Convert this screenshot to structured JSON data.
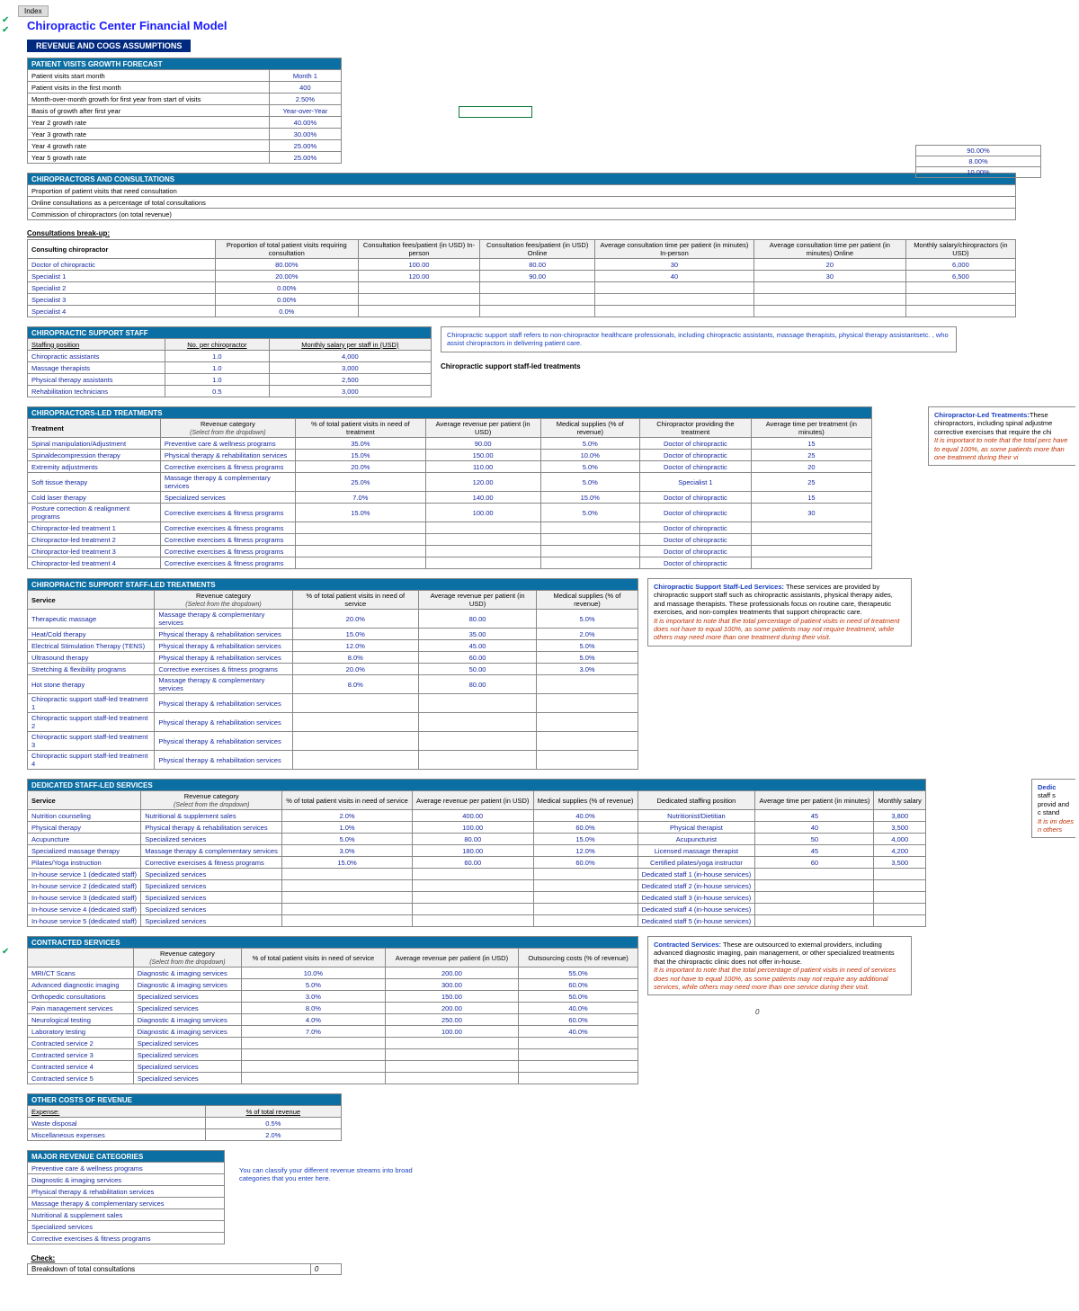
{
  "index_btn": "Index",
  "title": "Chiropractic Center Financial Model",
  "section_bar": "REVENUE AND COGS ASSUMPTIONS",
  "patient_visits": {
    "header": "PATIENT VISITS GROWTH FORECAST",
    "rows": [
      {
        "label": "Patient visits start month",
        "val": "Month 1"
      },
      {
        "label": "Patient visits in the first month",
        "val": "400"
      },
      {
        "label": "Month-over-month growth for first year from start of visits",
        "val": "2.50%"
      },
      {
        "label": "Basis of growth after first year",
        "val": "Year-over-Year"
      },
      {
        "label": "Year 2 growth rate",
        "val": "40.00%"
      },
      {
        "label": "Year 3 growth rate",
        "val": "30.00%"
      },
      {
        "label": "Year 4 growth rate",
        "val": "25.00%"
      },
      {
        "label": "Year 5 growth rate",
        "val": "25.00%"
      }
    ]
  },
  "chiro_consult": {
    "header": "CHIROPRACTORS AND CONSULTATIONS",
    "rows": [
      {
        "label": "Proportion of patient visits that need consultation",
        "val": "90.00%"
      },
      {
        "label": "Online consultations as a percentage of total consultations",
        "val": "8.00%"
      },
      {
        "label": "Commission of chiropractors (on total revenue)",
        "val": "10.00%"
      }
    ],
    "breakup_label": "Consultations break-up:",
    "role_label": "Consulting chiropractor",
    "cols": [
      "Proportion of total patient visits requiring consultation",
      "Consultation fees/patient (in USD) In-person",
      "Consultation fees/patient (in USD) Online",
      "Average consultation time per patient (in minutes) In-person",
      "Average consultation time per patient (in minutes) Online",
      "Monthly salary/chiropractors (in USD)"
    ],
    "data": [
      {
        "role": "Doctor of chiropractic",
        "prop": "80.00%",
        "fee_in": "100.00",
        "fee_on": "80.00",
        "t_in": "30",
        "t_on": "20",
        "sal": "6,000"
      },
      {
        "role": "Specialist 1",
        "prop": "20.00%",
        "fee_in": "120.00",
        "fee_on": "90.00",
        "t_in": "40",
        "t_on": "30",
        "sal": "6,500"
      },
      {
        "role": "Specialist 2",
        "prop": "0.00%",
        "fee_in": "",
        "fee_on": "",
        "t_in": "",
        "t_on": "",
        "sal": ""
      },
      {
        "role": "Specialist 3",
        "prop": "0.00%",
        "fee_in": "",
        "fee_on": "",
        "t_in": "",
        "t_on": "",
        "sal": ""
      },
      {
        "role": "Specialist 4",
        "prop": "0.0%",
        "fee_in": "",
        "fee_on": "",
        "t_in": "",
        "t_on": "",
        "sal": ""
      }
    ]
  },
  "support_staff": {
    "header": "CHIROPRACTIC SUPPORT STAFF",
    "cols": [
      "Staffing position",
      "No. per chiropractor",
      "Monthly salary per staff in (USD)"
    ],
    "rows": [
      {
        "pos": "Chiropractic assistants",
        "n": "1.0",
        "sal": "4,000"
      },
      {
        "pos": "Massage therapists",
        "n": "1.0",
        "sal": "3,000"
      },
      {
        "pos": "Physical therapy assistants",
        "n": "1.0",
        "sal": "2,500"
      },
      {
        "pos": "Rehabilitation technicians",
        "n": "0.5",
        "sal": "3,000"
      }
    ],
    "side_label": "Chiropractic support staff-led treatments",
    "box": "Chiropractic support staff refers to non-chiropractor healthcare professionals, including chiropractic assistants, massage therapists, physical therapy assistantsetc. , who assist chiropractors in delivering patient care."
  },
  "chiro_led": {
    "header": "CHIROPRACTORS-LED TREATMENTS",
    "cols": [
      "Treatment",
      "Revenue category",
      "% of total patient visits in need of treatment",
      "Average revenue per patient (in USD)",
      "Medical supplies (% of revenue)",
      "Chiropractor providing the treatment",
      "Average time per treatment (in minutes)"
    ],
    "ital": "(Select from the dropdown)",
    "rows": [
      {
        "t": "Spinal manipulation/Adjustment",
        "cat": "Preventive care & wellness programs",
        "pct": "35.0%",
        "rev": "90.00",
        "sup": "5.0%",
        "who": "Doctor of chiropractic",
        "time": "15"
      },
      {
        "t": "Spinaldecompression therapy",
        "cat": "Physical therapy & rehabilitation services",
        "pct": "15.0%",
        "rev": "150.00",
        "sup": "10.0%",
        "who": "Doctor of chiropractic",
        "time": "25"
      },
      {
        "t": "Extremity adjustments",
        "cat": "Corrective exercises & fitness programs",
        "pct": "20.0%",
        "rev": "110.00",
        "sup": "5.0%",
        "who": "Doctor of chiropractic",
        "time": "20"
      },
      {
        "t": "Soft tissue therapy",
        "cat": "Massage therapy & complementary services",
        "pct": "25.0%",
        "rev": "120.00",
        "sup": "5.0%",
        "who": "Specialist 1",
        "time": "25"
      },
      {
        "t": "Cold laser therapy",
        "cat": "Specialized services",
        "pct": "7.0%",
        "rev": "140.00",
        "sup": "15.0%",
        "who": "Doctor of chiropractic",
        "time": "15"
      },
      {
        "t": "Posture correction & realignment programs",
        "cat": "Corrective exercises & fitness programs",
        "pct": "15.0%",
        "rev": "100.00",
        "sup": "5.0%",
        "who": "Doctor of chiropractic",
        "time": "30"
      },
      {
        "t": "Chiropractor-led treatment 1",
        "cat": "Corrective exercises & fitness programs",
        "pct": "",
        "rev": "",
        "sup": "",
        "who": "Doctor of chiropractic",
        "time": ""
      },
      {
        "t": "Chiropractor-led treatment 2",
        "cat": "Corrective exercises & fitness programs",
        "pct": "",
        "rev": "",
        "sup": "",
        "who": "Doctor of chiropractic",
        "time": ""
      },
      {
        "t": "Chiropractor-led treatment 3",
        "cat": "Corrective exercises & fitness programs",
        "pct": "",
        "rev": "",
        "sup": "",
        "who": "Doctor of chiropractic",
        "time": ""
      },
      {
        "t": "Chiropractor-led treatment 4",
        "cat": "Corrective exercises & fitness programs",
        "pct": "",
        "rev": "",
        "sup": "",
        "who": "Doctor of chiropractic",
        "time": ""
      }
    ],
    "box_lead": "Chiropractor-Led Treatments:",
    "box_body": "These chiropractors, including spinal adjustme corrective exercises that require the chi",
    "box_warn": "It is important to note that the total perc have to equal 100%, as some patients more than one treatment during their vi"
  },
  "support_led": {
    "header": "CHIROPRACTIC SUPPORT STAFF-LED TREATMENTS",
    "cols": [
      "Service",
      "Revenue category",
      "% of total patient visits in need of service",
      "Average revenue per patient (in USD)",
      "Medical supplies (% of revenue)"
    ],
    "ital": "(Select from the dropdown)",
    "rows": [
      {
        "s": "Therapeutic massage",
        "cat": "Massage therapy & complementary services",
        "pct": "20.0%",
        "rev": "80.00",
        "sup": "5.0%"
      },
      {
        "s": "Heat/Cold therapy",
        "cat": "Physical therapy & rehabilitation services",
        "pct": "15.0%",
        "rev": "35.00",
        "sup": "2.0%"
      },
      {
        "s": "Electrical Stimulation Therapy (TENS)",
        "cat": "Physical therapy & rehabilitation services",
        "pct": "12.0%",
        "rev": "45.00",
        "sup": "5.0%"
      },
      {
        "s": "Ultrasound therapy",
        "cat": "Physical therapy & rehabilitation services",
        "pct": "8.0%",
        "rev": "60.00",
        "sup": "5.0%"
      },
      {
        "s": "Stretching & flexibility programs",
        "cat": "Corrective exercises & fitness programs",
        "pct": "20.0%",
        "rev": "50.00",
        "sup": "3.0%"
      },
      {
        "s": "Hot stone therapy",
        "cat": "Massage therapy & complementary services",
        "pct": "8.0%",
        "rev": "80.00",
        "sup": ""
      },
      {
        "s": "Chiropractic support staff-led treatment 1",
        "cat": "Physical therapy & rehabilitation services",
        "pct": "",
        "rev": "",
        "sup": ""
      },
      {
        "s": "Chiropractic support staff-led treatment 2",
        "cat": "Physical therapy & rehabilitation services",
        "pct": "",
        "rev": "",
        "sup": ""
      },
      {
        "s": "Chiropractic support staff-led treatment 3",
        "cat": "Physical therapy & rehabilitation services",
        "pct": "",
        "rev": "",
        "sup": ""
      },
      {
        "s": "Chiropractic support staff-led treatment 4",
        "cat": "Physical therapy & rehabilitation services",
        "pct": "",
        "rev": "",
        "sup": ""
      }
    ],
    "box_lead": "Chiropractic Support Staff-Led Services:",
    "box_body": " These services are provided by chiropractic support staff such as chiropractic assistants, physical therapy aides, and massage therapists. These professionals focus on routine care, therapeutic exercises, and non-complex treatments that support chiropractic care.",
    "box_warn": "It is important to note that the total percentage of patient visits in need of treatment does not have to equal 100%, as some patients may not require treatment, while others may need more than one treatment during their visit."
  },
  "dedicated": {
    "header": "DEDICATED STAFF-LED SERVICES",
    "cols": [
      "Service",
      "Revenue category",
      "% of total patient visits in need of service",
      "Average revenue per patient (in USD)",
      "Medical supplies (% of revenue)",
      "Dedicated staffing position",
      "Average time per patient (in minutes)",
      "Monthly salary"
    ],
    "ital": "(Select from the dropdown)",
    "rows": [
      {
        "s": "Nutrition counseling",
        "cat": "Nutritional & supplement sales",
        "pct": "2.0%",
        "rev": "400.00",
        "sup": "40.0%",
        "pos": "Nutritionist/Dietitian",
        "time": "45",
        "sal": "3,800"
      },
      {
        "s": "Physical therapy",
        "cat": "Physical therapy & rehabilitation services",
        "pct": "1.0%",
        "rev": "100.00",
        "sup": "60.0%",
        "pos": "Physical therapist",
        "time": "40",
        "sal": "3,500"
      },
      {
        "s": "Acupuncture",
        "cat": "Specialized services",
        "pct": "5.0%",
        "rev": "80.00",
        "sup": "15.0%",
        "pos": "Acupuncturist",
        "time": "50",
        "sal": "4,000"
      },
      {
        "s": "Specialized massage therapy",
        "cat": "Massage therapy & complementary services",
        "pct": "3.0%",
        "rev": "180.00",
        "sup": "12.0%",
        "pos": "Licensed massage therapist",
        "time": "45",
        "sal": "4,200"
      },
      {
        "s": "Pilates/Yoga instruction",
        "cat": "Corrective exercises & fitness programs",
        "pct": "15.0%",
        "rev": "60.00",
        "sup": "60.0%",
        "pos": "Certified pilates/yoga instructor",
        "time": "60",
        "sal": "3,500"
      },
      {
        "s": "In-house service 1 (dedicated staff)",
        "cat": "Specialized services",
        "pct": "",
        "rev": "",
        "sup": "",
        "pos": "Dedicated staff 1 (in-house services)",
        "time": "",
        "sal": ""
      },
      {
        "s": "In-house service 2 (dedicated staff)",
        "cat": "Specialized services",
        "pct": "",
        "rev": "",
        "sup": "",
        "pos": "Dedicated staff 2 (in-house services)",
        "time": "",
        "sal": ""
      },
      {
        "s": "In-house service 3 (dedicated staff)",
        "cat": "Specialized services",
        "pct": "",
        "rev": "",
        "sup": "",
        "pos": "Dedicated staff 3 (in-house services)",
        "time": "",
        "sal": ""
      },
      {
        "s": "In-house service 4 (dedicated staff)",
        "cat": "Specialized services",
        "pct": "",
        "rev": "",
        "sup": "",
        "pos": "Dedicated staff 4 (in-house services)",
        "time": "",
        "sal": ""
      },
      {
        "s": "In-house service 5 (dedicated staff)",
        "cat": "Specialized services",
        "pct": "",
        "rev": "",
        "sup": "",
        "pos": "Dedicated staff 5 (in-house services)",
        "time": "",
        "sal": ""
      }
    ],
    "box_lead": "Dedic",
    "box_body": "staff s provid and c stand",
    "box_warn": "It is im does n others"
  },
  "contracted": {
    "header": "CONTRACTED SERVICES",
    "cols": [
      "",
      "Revenue category",
      "% of total patient visits in need of service",
      "Average revenue per patient (in USD)",
      "Outsourcing costs (% of revenue)"
    ],
    "ital": "(Select from the dropdown)",
    "rows": [
      {
        "s": "MRI/CT Scans",
        "cat": "Diagnostic & imaging services",
        "pct": "10.0%",
        "rev": "200.00",
        "out": "55.0%"
      },
      {
        "s": "Advanced diagnostic imaging",
        "cat": "Diagnostic & imaging services",
        "pct": "5.0%",
        "rev": "300.00",
        "out": "60.0%"
      },
      {
        "s": "Orthopedic consultations",
        "cat": "Specialized services",
        "pct": "3.0%",
        "rev": "150.00",
        "out": "50.0%"
      },
      {
        "s": "Pain management services",
        "cat": "Specialized services",
        "pct": "8.0%",
        "rev": "200.00",
        "out": "40.0%"
      },
      {
        "s": "Neurological testing",
        "cat": "Diagnostic & imaging services",
        "pct": "4.0%",
        "rev": "250.00",
        "out": "60.0%"
      },
      {
        "s": "Laboratory testing",
        "cat": "Diagnostic & imaging services",
        "pct": "7.0%",
        "rev": "100.00",
        "out": "40.0%"
      },
      {
        "s": "Contracted service 2",
        "cat": "Specialized services",
        "pct": "",
        "rev": "",
        "out": ""
      },
      {
        "s": "Contracted service 3",
        "cat": "Specialized services",
        "pct": "",
        "rev": "",
        "out": ""
      },
      {
        "s": "Contracted service 4",
        "cat": "Specialized services",
        "pct": "",
        "rev": "",
        "out": ""
      },
      {
        "s": "Contracted service 5",
        "cat": "Specialized services",
        "pct": "",
        "rev": "",
        "out": ""
      }
    ],
    "box_lead": "Contracted Services:",
    "box_body": " These are outsourced to external providers, including advanced diagnostic imaging, pain management, or other specialized treatments that the chiropractic clinic does not offer in-house.",
    "box_warn": "It is important to note that the total percentage of patient visits in need of services does not have to equal 100%, as some patients may not require any additional services, while others may need more than one service during their visit.",
    "tiny_zero": "0"
  },
  "other_costs": {
    "header": "OTHER COSTS OF REVENUE",
    "cols": [
      "Expense:",
      "% of total revenue"
    ],
    "rows": [
      {
        "e": "Waste disposal",
        "v": "0.5%"
      },
      {
        "e": "Miscellaneous expenses",
        "v": "2.0%"
      }
    ]
  },
  "major_rev": {
    "header": "MAJOR REVENUE CATEGORIES",
    "rows": [
      "Preventive care & wellness programs",
      "Diagnostic & imaging services",
      "Physical therapy & rehabilitation services",
      "Massage therapy & complementary services",
      "Nutritional & supplement sales",
      "Specialized services",
      "Corrective exercises & fitness programs"
    ],
    "box": "You can classify your different revenue streams into broad categories that you enter here."
  },
  "check": {
    "label": "Check:",
    "row": "Breakdown of total consultations",
    "val": "0"
  }
}
